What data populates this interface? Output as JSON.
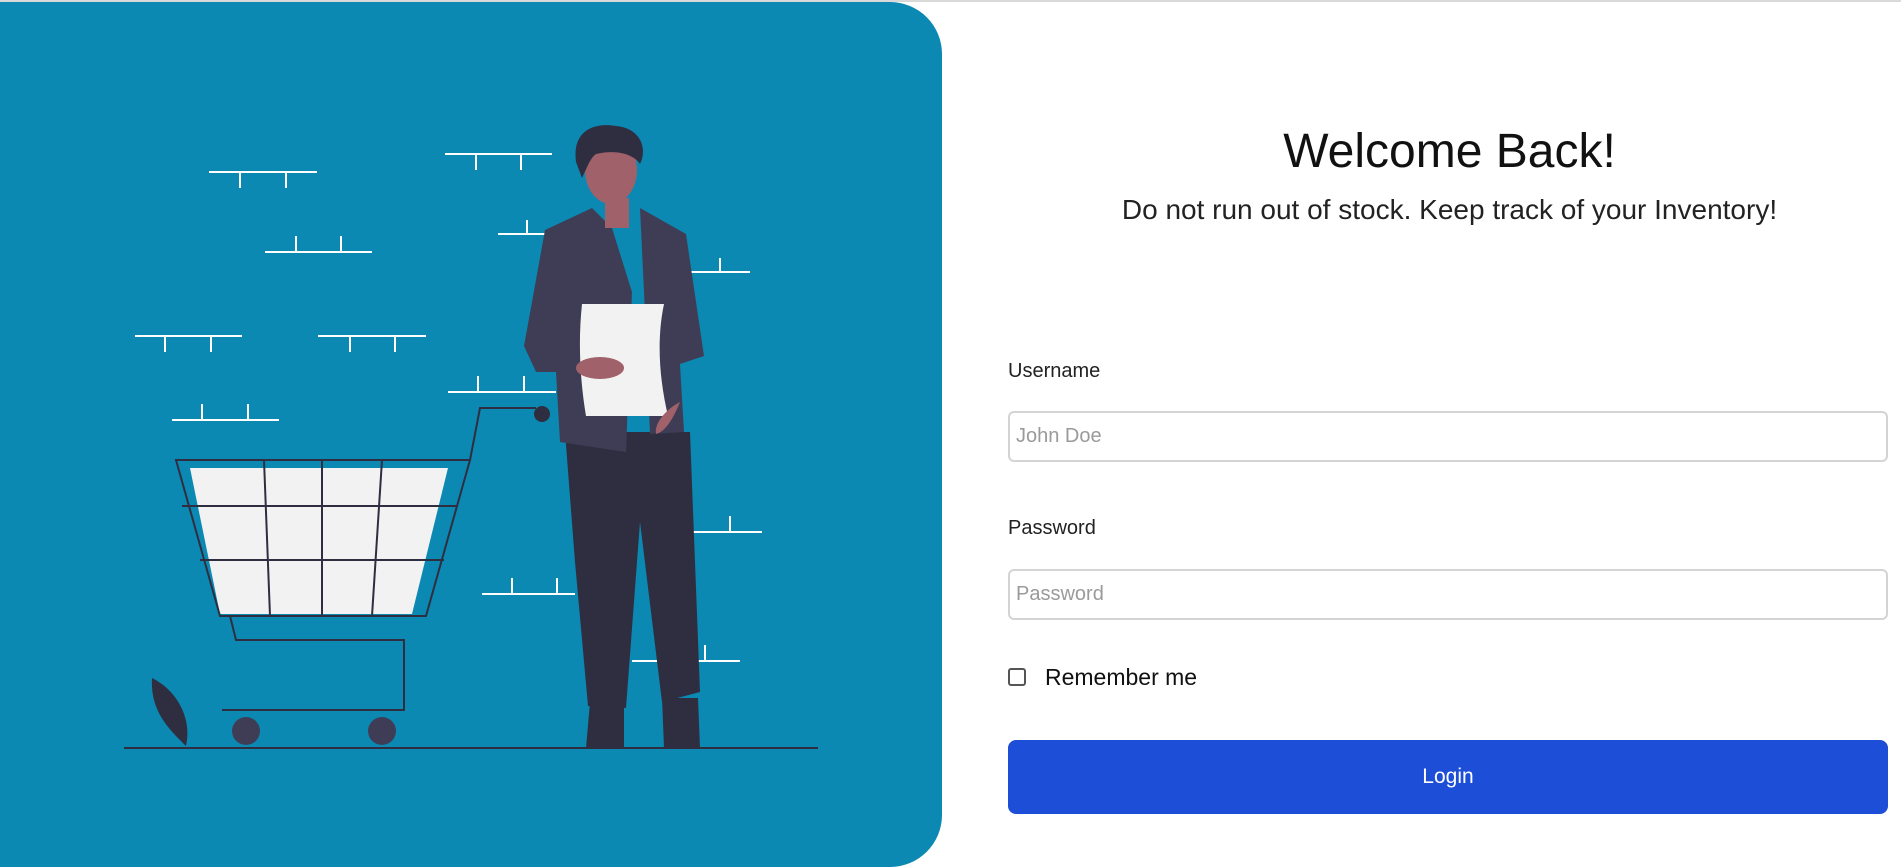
{
  "theme": {
    "panel_color": "#0b89b3",
    "button_color": "#1d4ed8"
  },
  "illustration": {
    "name": "shopping-cart-man-illustration"
  },
  "login": {
    "title": "Welcome Back!",
    "subtitle": "Do not run out of stock. Keep track of your Inventory!",
    "username_label": "Username",
    "username_placeholder": "John Doe",
    "username_value": "",
    "password_label": "Password",
    "password_placeholder": "Password",
    "password_value": "",
    "remember_label": "Remember me",
    "remember_checked": false,
    "button_label": "Login"
  }
}
